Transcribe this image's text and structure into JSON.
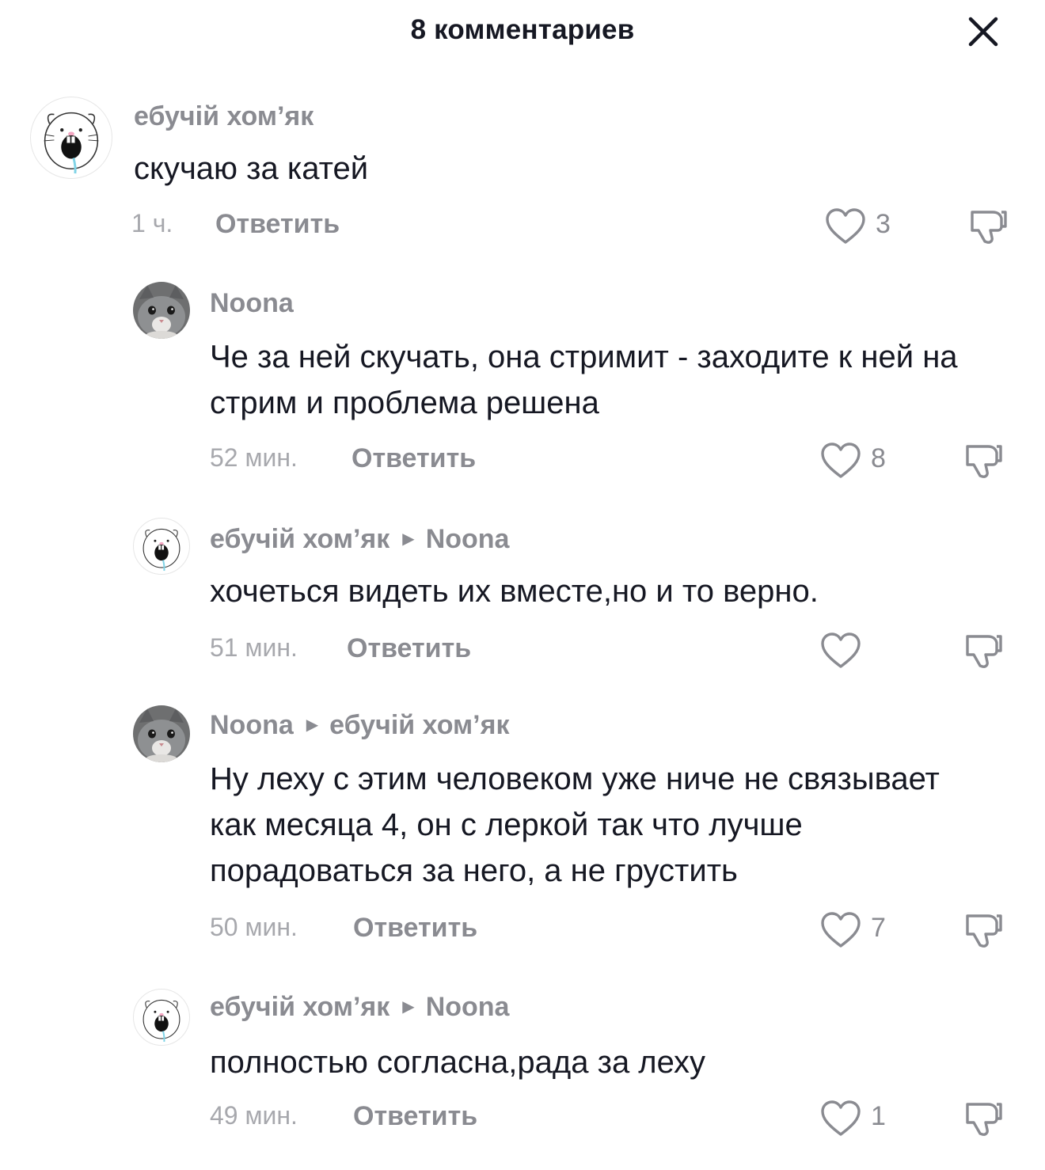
{
  "header": {
    "title": "8 комментариев"
  },
  "comments": [
    {
      "author": "ебучій хом’як",
      "reply_to": "",
      "text": "скучаю за катей",
      "time": "1 ч.",
      "reply_label": "Ответить",
      "likes": "3",
      "avatar": "hamster-avatar"
    },
    {
      "author": "Noona",
      "reply_to": "",
      "text": "Че за ней скучать, она стримит - заходите к ней на стрим и проблема решена",
      "time": "52 мин.",
      "reply_label": "Ответить",
      "likes": "8",
      "avatar": "kitten-avatar"
    },
    {
      "author": "ебучій хом’як",
      "reply_to": "Noona",
      "text": "хочеться видеть их вместе,но и то верно.",
      "time": "51 мин.",
      "reply_label": "Ответить",
      "likes": "",
      "avatar": "hamster-avatar"
    },
    {
      "author": "Noona",
      "reply_to": "ебучій хом’як",
      "text": "Ну леху с этим человеком уже ниче не связывает как месяца 4, он с леркой так что лучше порадоваться за него, а не грустить",
      "time": "50 мин.",
      "reply_label": "Ответить",
      "likes": "7",
      "avatar": "kitten-avatar"
    },
    {
      "author": "ебучій хом’як",
      "reply_to": "Noona",
      "text": "полностью согласна,рада за леху",
      "time": "49 мин.",
      "reply_label": "Ответить",
      "likes": "1",
      "avatar": "hamster-avatar"
    }
  ],
  "icons": {
    "close": "close-icon",
    "like": "heart-outline-icon",
    "dislike": "thumbs-down-outline-icon",
    "reply_arrow": "triangle-right-icon"
  },
  "colors": {
    "text_primary": "#161823",
    "text_secondary": "#8a8b91",
    "text_tertiary": "#a7a8ad",
    "background": "#ffffff"
  }
}
